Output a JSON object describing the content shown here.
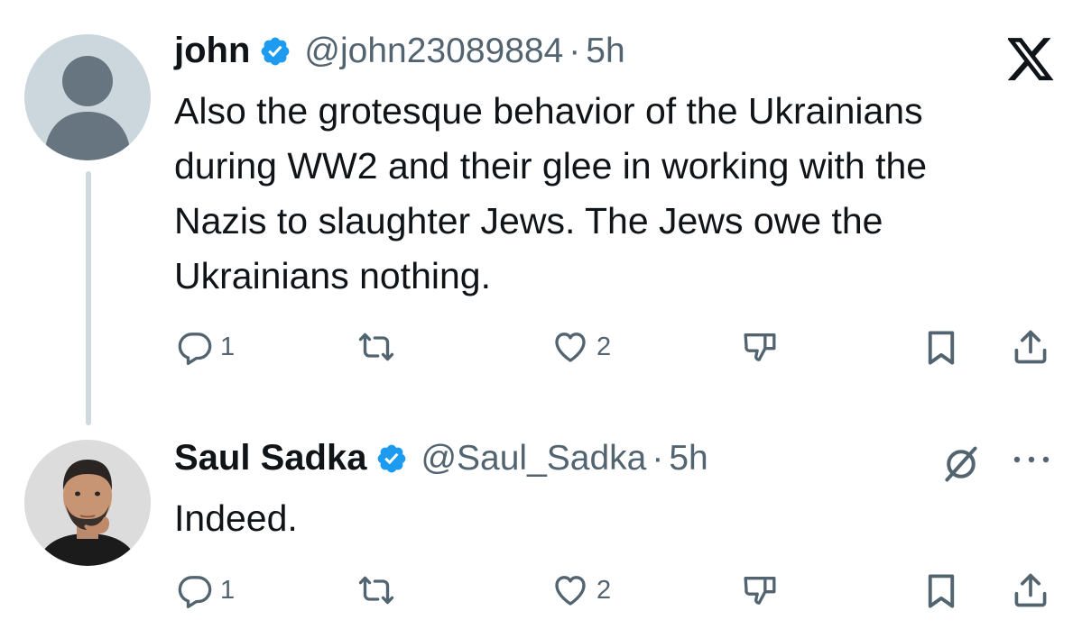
{
  "tweets": [
    {
      "name": "john",
      "handle": "@john23089884",
      "separator": "·",
      "time": "5h",
      "text_lines": [
        "Also the grotesque behavior of the Ukrainians",
        "during WW2 and their glee in working with the",
        "Nazis to slaughter Jews. The Jews owe the",
        "Ukrainians nothing."
      ],
      "reply_count": "1",
      "like_count": "2",
      "avatar": "default-avatar-icon"
    },
    {
      "name": "Saul Sadka",
      "handle": "@Saul_Sadka",
      "separator": "·",
      "time": "5h",
      "text_lines": [
        "Indeed."
      ],
      "reply_count": "1",
      "like_count": "2",
      "avatar": "profile-photo"
    }
  ],
  "colors": {
    "verified": "#1d9bf0",
    "muted": "#536471",
    "text": "#0f1419",
    "thread_line": "#cfd9de"
  }
}
